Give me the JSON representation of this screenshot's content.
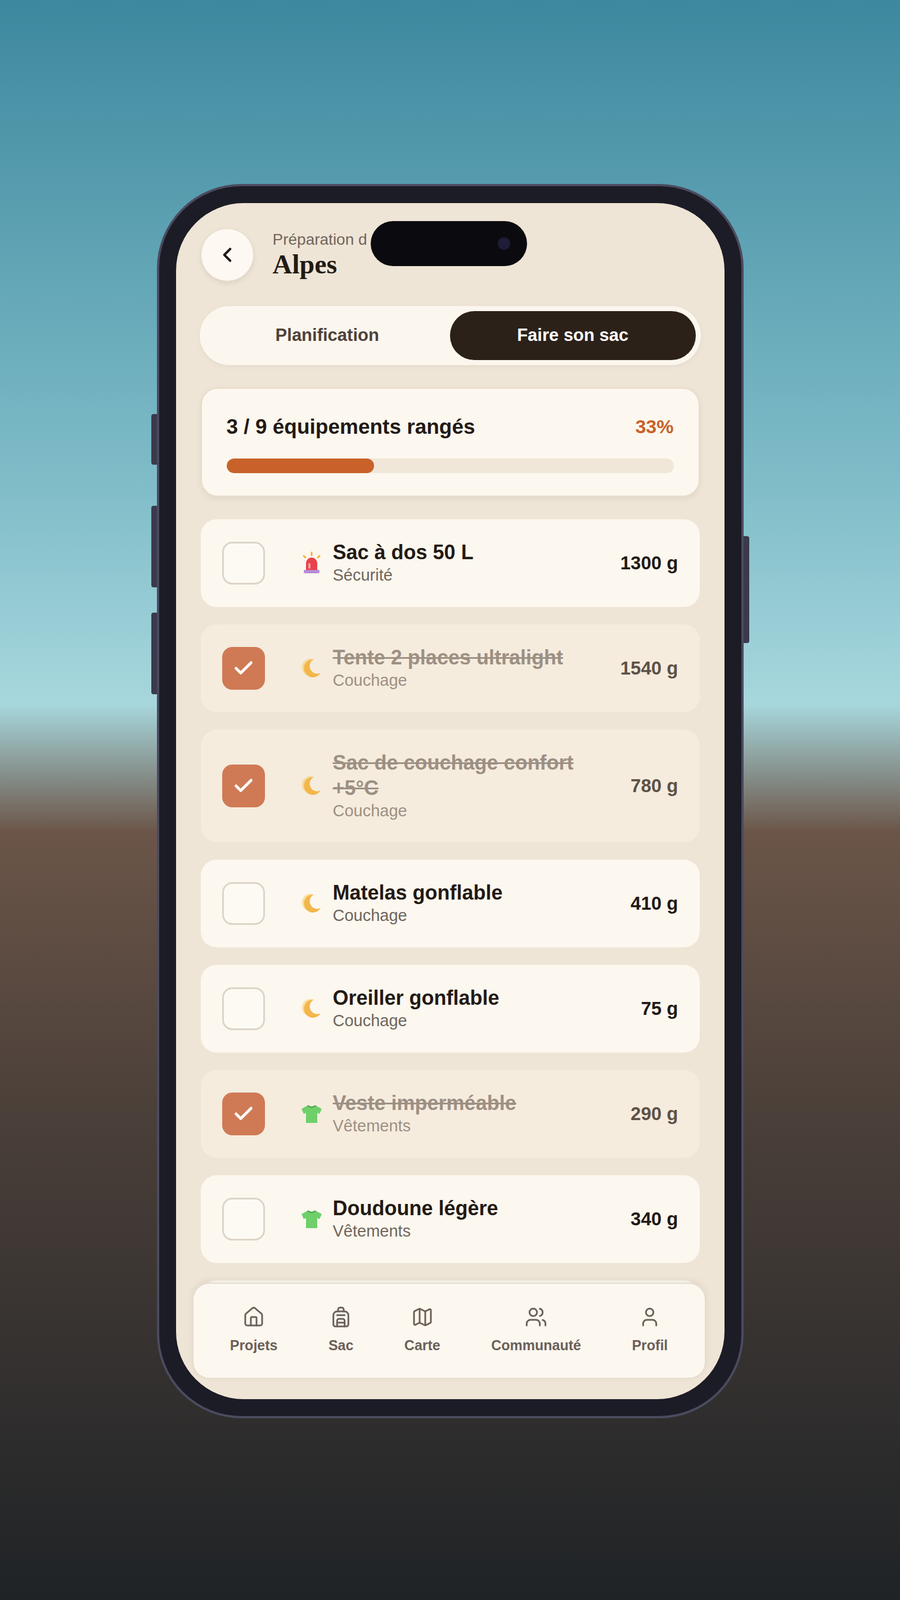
{
  "header": {
    "subtitle": "Préparation d",
    "title": "Alpes"
  },
  "tabs": [
    {
      "label": "Planification",
      "selected": false
    },
    {
      "label": "Faire son sac",
      "selected": true
    }
  ],
  "progress": {
    "label": "3 / 9 équipements rangés",
    "percent": "33%",
    "level": 0.33
  },
  "items": [
    {
      "name": "Sac à dos 50 L",
      "category": "Sécurité",
      "kind": "security",
      "weight": "1300 g",
      "checked": false
    },
    {
      "name": "Tente 2 places ultralight",
      "category": "Couchage",
      "kind": "sleep",
      "weight": "1540 g",
      "checked": true
    },
    {
      "name": "Sac de couchage confort +5°C",
      "category": "Couchage",
      "kind": "sleep",
      "weight": "780 g",
      "checked": true
    },
    {
      "name": "Matelas gonflable",
      "category": "Couchage",
      "kind": "sleep",
      "weight": "410 g",
      "checked": false
    },
    {
      "name": "Oreiller gonflable",
      "category": "Couchage",
      "kind": "sleep",
      "weight": "75 g",
      "checked": false
    },
    {
      "name": "Veste imperméable",
      "category": "Vêtements",
      "kind": "clothing",
      "weight": "290 g",
      "checked": true
    },
    {
      "name": "Doudoune légère",
      "category": "Vêtements",
      "kind": "clothing",
      "weight": "340 g",
      "checked": false
    }
  ],
  "nav": [
    {
      "label": "Projets",
      "kind": "home",
      "selected": false
    },
    {
      "label": "Sac",
      "kind": "bag",
      "selected": false
    },
    {
      "label": "Carte",
      "kind": "map",
      "selected": false
    },
    {
      "label": "Communauté",
      "kind": "community",
      "selected": false
    },
    {
      "label": "Profil",
      "kind": "profile",
      "selected": false
    }
  ]
}
